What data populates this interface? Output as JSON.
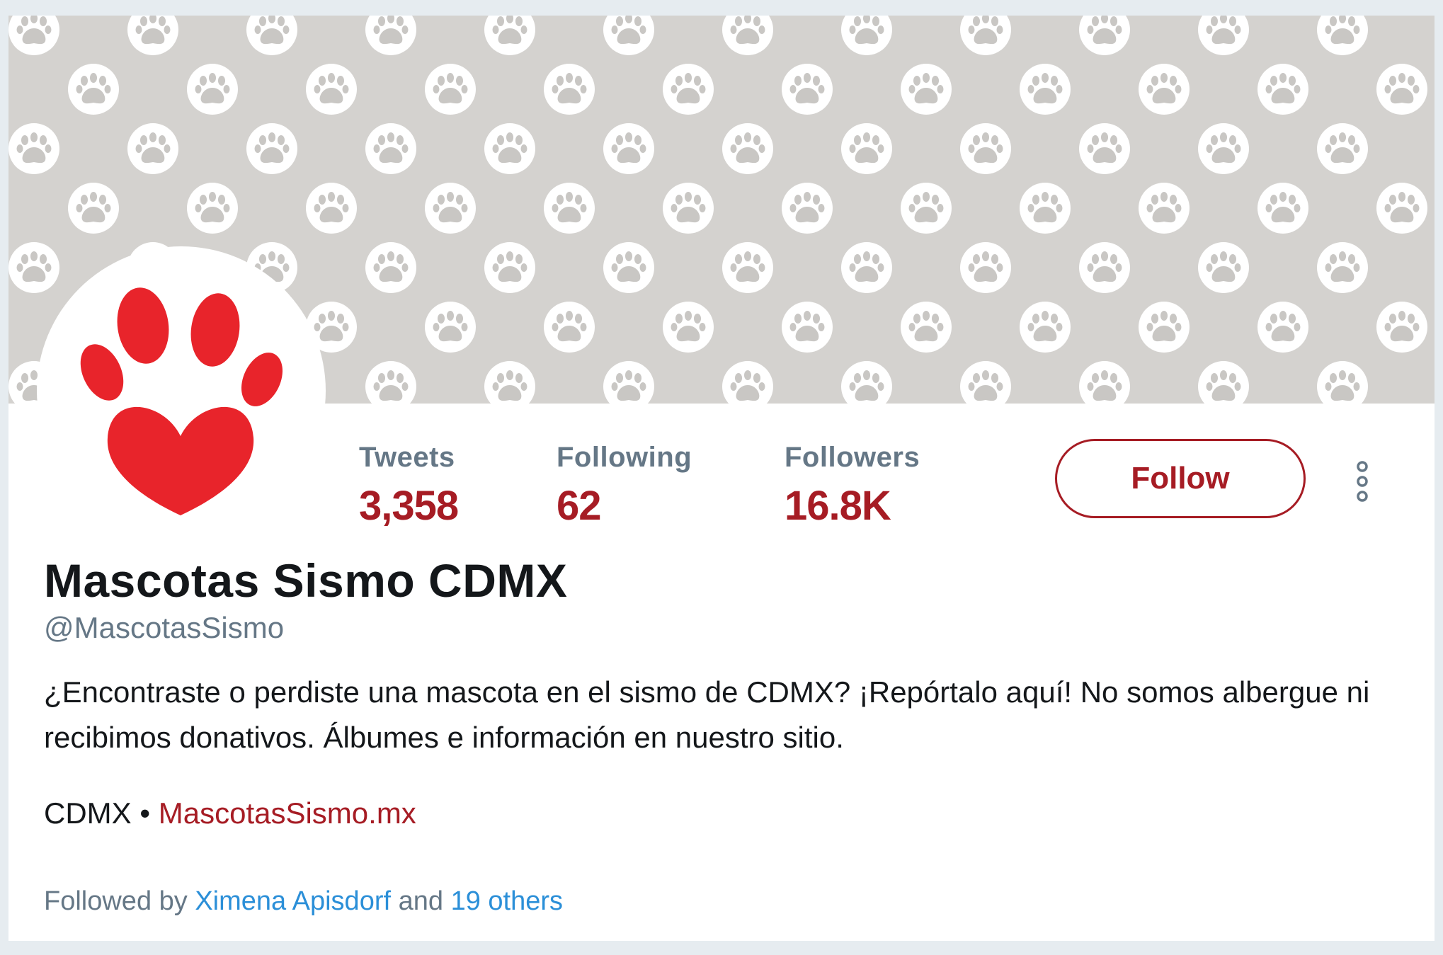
{
  "profile": {
    "display_name": "Mascotas Sismo CDMX",
    "handle": "@MascotasSismo",
    "bio": "¿Encontraste o perdiste una mascota en el sismo de CDMX? ¡Repórtalo aquí! No somos albergue ni recibimos donativos. Álbumes e información en nuestro sitio.",
    "location": "CDMX",
    "separator": "•",
    "website": "MascotasSismo.mx"
  },
  "stats": {
    "tweets_label": "Tweets",
    "tweets_value": "3,358",
    "following_label": "Following",
    "following_value": "62",
    "followers_label": "Followers",
    "followers_value": "16.8K"
  },
  "actions": {
    "follow_label": "Follow",
    "more_icon": "more-vertical-icon"
  },
  "followed_by": {
    "prefix": "Followed by",
    "user": "Ximena Apisdorf",
    "conjunction": "and",
    "others": "19 others"
  },
  "colors": {
    "accent": "#a61c24",
    "banner": "#d4d2cf",
    "paw_red": "#e8242b",
    "link_blue": "#2b8fd8",
    "secondary_text": "#657786",
    "primary_text": "#14171a"
  },
  "icons": {
    "banner_pattern": "paw-print-pattern",
    "avatar": "paw-heart-icon"
  }
}
